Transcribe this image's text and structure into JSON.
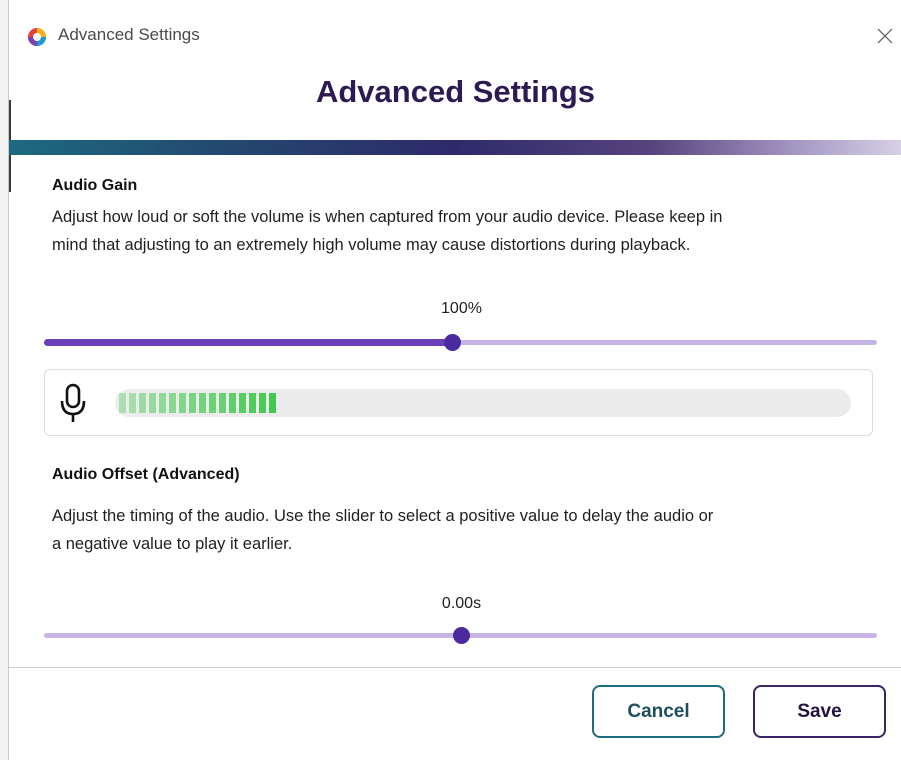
{
  "window": {
    "title": "Advanced Settings",
    "heading": "Advanced Settings",
    "icons": {
      "app": "app-logo-icon",
      "close": "close-icon"
    }
  },
  "audio_gain": {
    "title": "Audio Gain",
    "description_line1": "Adjust how loud or soft the volume is when captured from your audio device. Please keep in",
    "description_line2": "mind that adjusting to an extremely high volume may cause distortions during playback.",
    "value_label": "100%",
    "slider_fraction": 0.49,
    "mic_icon": "microphone-icon",
    "level_meter_fraction": 0.22,
    "colors": {
      "track": "#c7b4e4",
      "fill": "#6a3fb7",
      "thumb": "#4b2aa0",
      "meter": "#3cc84a"
    }
  },
  "audio_offset": {
    "title": "Audio Offset (Advanced)",
    "description_line1": "Adjust the timing of the audio. Use the slider to select a positive value to delay the audio or",
    "description_line2": "a negative value to play it earlier.",
    "value_label": "0.00s",
    "slider_fraction": 0.5
  },
  "footer": {
    "cancel_label": "Cancel",
    "save_label": "Save",
    "colors": {
      "cancel_border": "#1f6b7f",
      "save_border": "#3a2466"
    }
  }
}
